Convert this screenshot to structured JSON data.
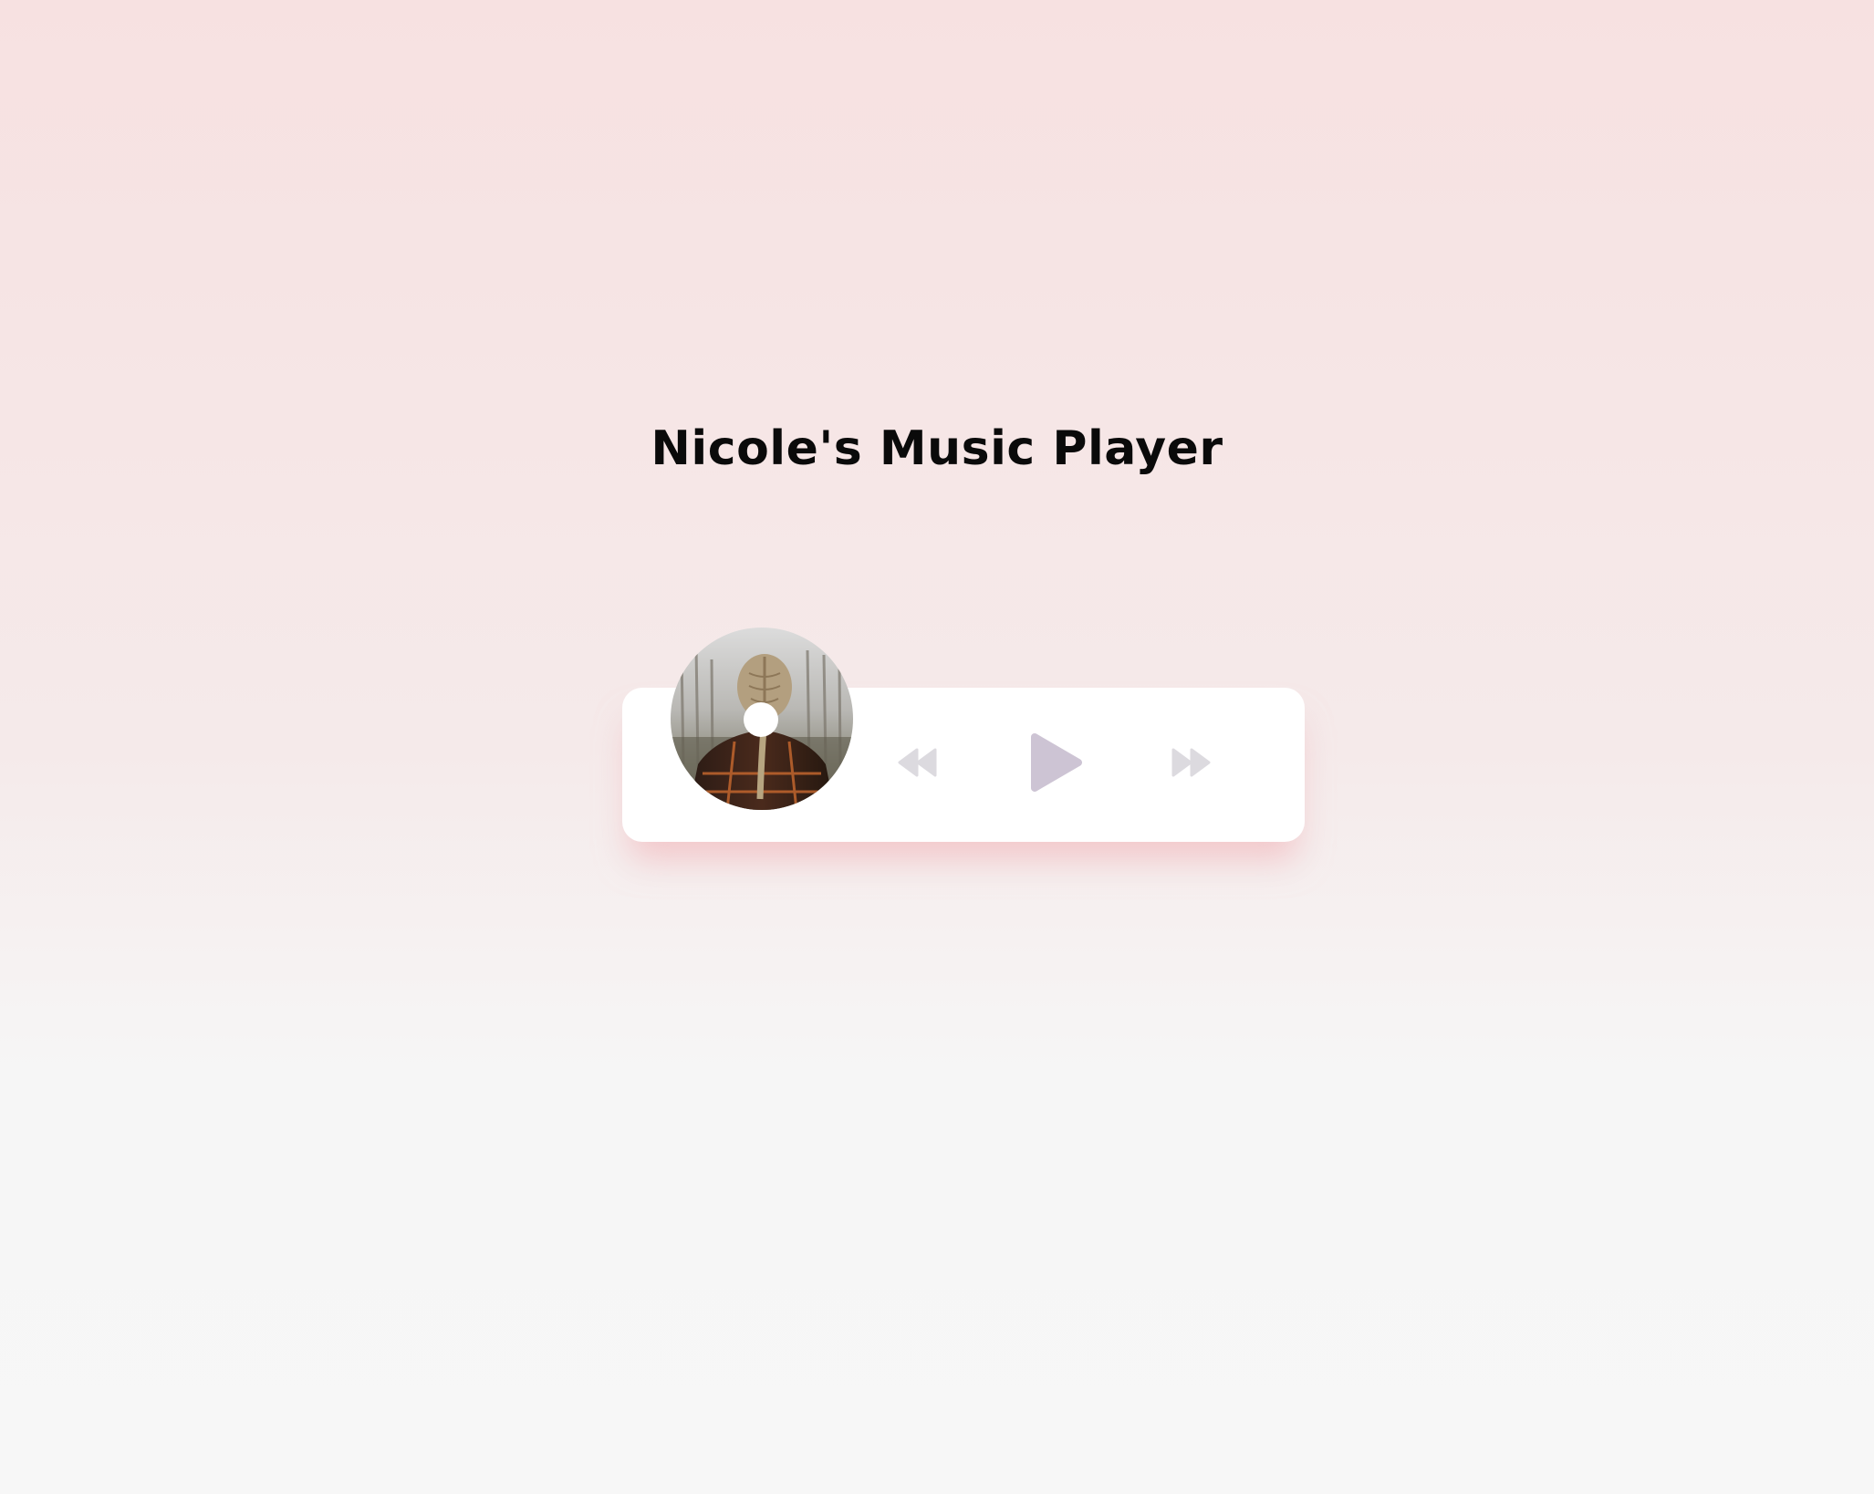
{
  "page": {
    "title": "Nicole's Music Player"
  },
  "player": {
    "album_art": "album-cover",
    "controls": {
      "prev_icon": "backward-icon",
      "play_icon": "play-icon",
      "next_icon": "forward-icon"
    }
  },
  "colors": {
    "card_background": "#ffffff",
    "control_icon": "#dcdadf",
    "play_icon": "#cdc4d4",
    "title_text": "#0a0a0a"
  }
}
